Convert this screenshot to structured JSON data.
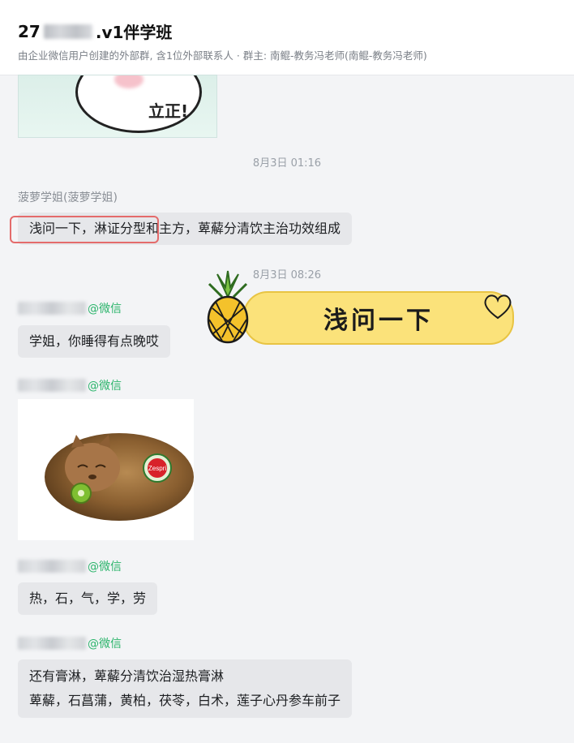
{
  "header": {
    "title_prefix": "27",
    "title_suffix": ".v1伴学班",
    "subtitle": "由企业微信用户创建的外部群, 含1位外部联系人 · 群主: 南鲲-教务冯老师(南鲲-教务冯老师)"
  },
  "top_sticker": {
    "text": "立正!"
  },
  "messages": [
    {
      "time": "8月3日 01:16"
    },
    {
      "sender": "菠萝学姐(菠萝学姐)",
      "text": "浅问一下，淋证分型和主方，萆薢分清饮主治功效组成"
    },
    {
      "time": "8月3日 08:26"
    },
    {
      "sender_suffix": "@微信",
      "text": "学姐，你睡得有点晚哎"
    },
    {
      "sender_suffix": "@微信",
      "image": "cat-kiwi-sticker"
    },
    {
      "sender_suffix": "@微信",
      "text": "热，石，气，学，劳"
    },
    {
      "sender_suffix": "@微信",
      "lines": [
        "还有膏淋，萆薢分清饮治湿热膏淋",
        "萆薢，石菖蒲，黄柏，茯苓，白术，莲子心丹参车前子"
      ]
    }
  ],
  "overlay": {
    "banner_text": "浅问一下",
    "icons": [
      "pineapple-icon",
      "heart-icon"
    ]
  },
  "cat_sticker": {
    "label": "Zespri"
  },
  "colors": {
    "wechat_green": "#2bb46b",
    "bubble_bg": "#e6e7ea",
    "banner_yellow": "#fbe27a",
    "highlight_red": "#e46b6b"
  }
}
